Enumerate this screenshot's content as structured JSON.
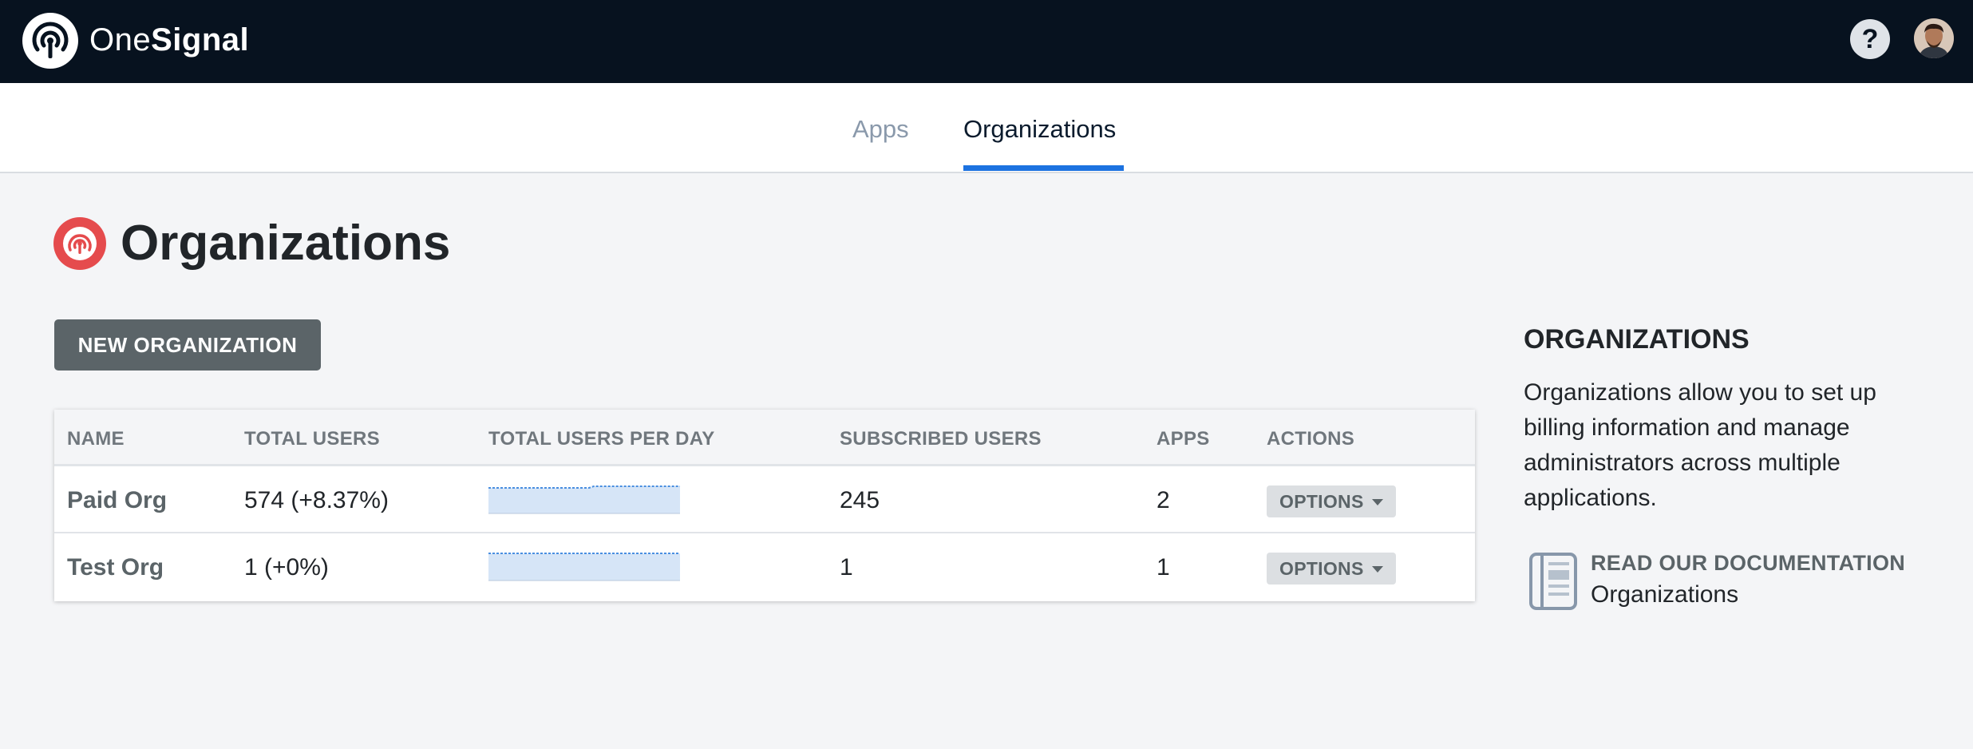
{
  "brand": {
    "name_light": "One",
    "name_bold": "Signal"
  },
  "header": {
    "help_label": "?"
  },
  "tabs": [
    {
      "label": "Apps",
      "active": false
    },
    {
      "label": "Organizations",
      "active": true
    }
  ],
  "page": {
    "title": "Organizations",
    "new_button_label": "NEW ORGANIZATION"
  },
  "table": {
    "headers": [
      "NAME",
      "TOTAL USERS",
      "TOTAL USERS PER DAY",
      "SUBSCRIBED USERS",
      "APPS",
      "ACTIONS"
    ],
    "rows": [
      {
        "name": "Paid Org",
        "total_users": "574  (+8.37%)",
        "subscribed_users": "245",
        "apps": "2",
        "action_label": "OPTIONS"
      },
      {
        "name": "Test Org",
        "total_users": "1  (+0%)",
        "subscribed_users": "1",
        "apps": "1",
        "action_label": "OPTIONS"
      }
    ]
  },
  "sidebar": {
    "title": "ORGANIZATIONS",
    "description": "Organizations allow you to set up billing information and manage administrators across multiple applications.",
    "doc_link_title": "READ OUR DOCUMENTATION",
    "doc_link_subtitle": "Organizations"
  },
  "colors": {
    "topbar": "#07121f",
    "accent_blue": "#1c72e0",
    "brand_red": "#e54b4d",
    "button_gray": "#5b6468"
  }
}
